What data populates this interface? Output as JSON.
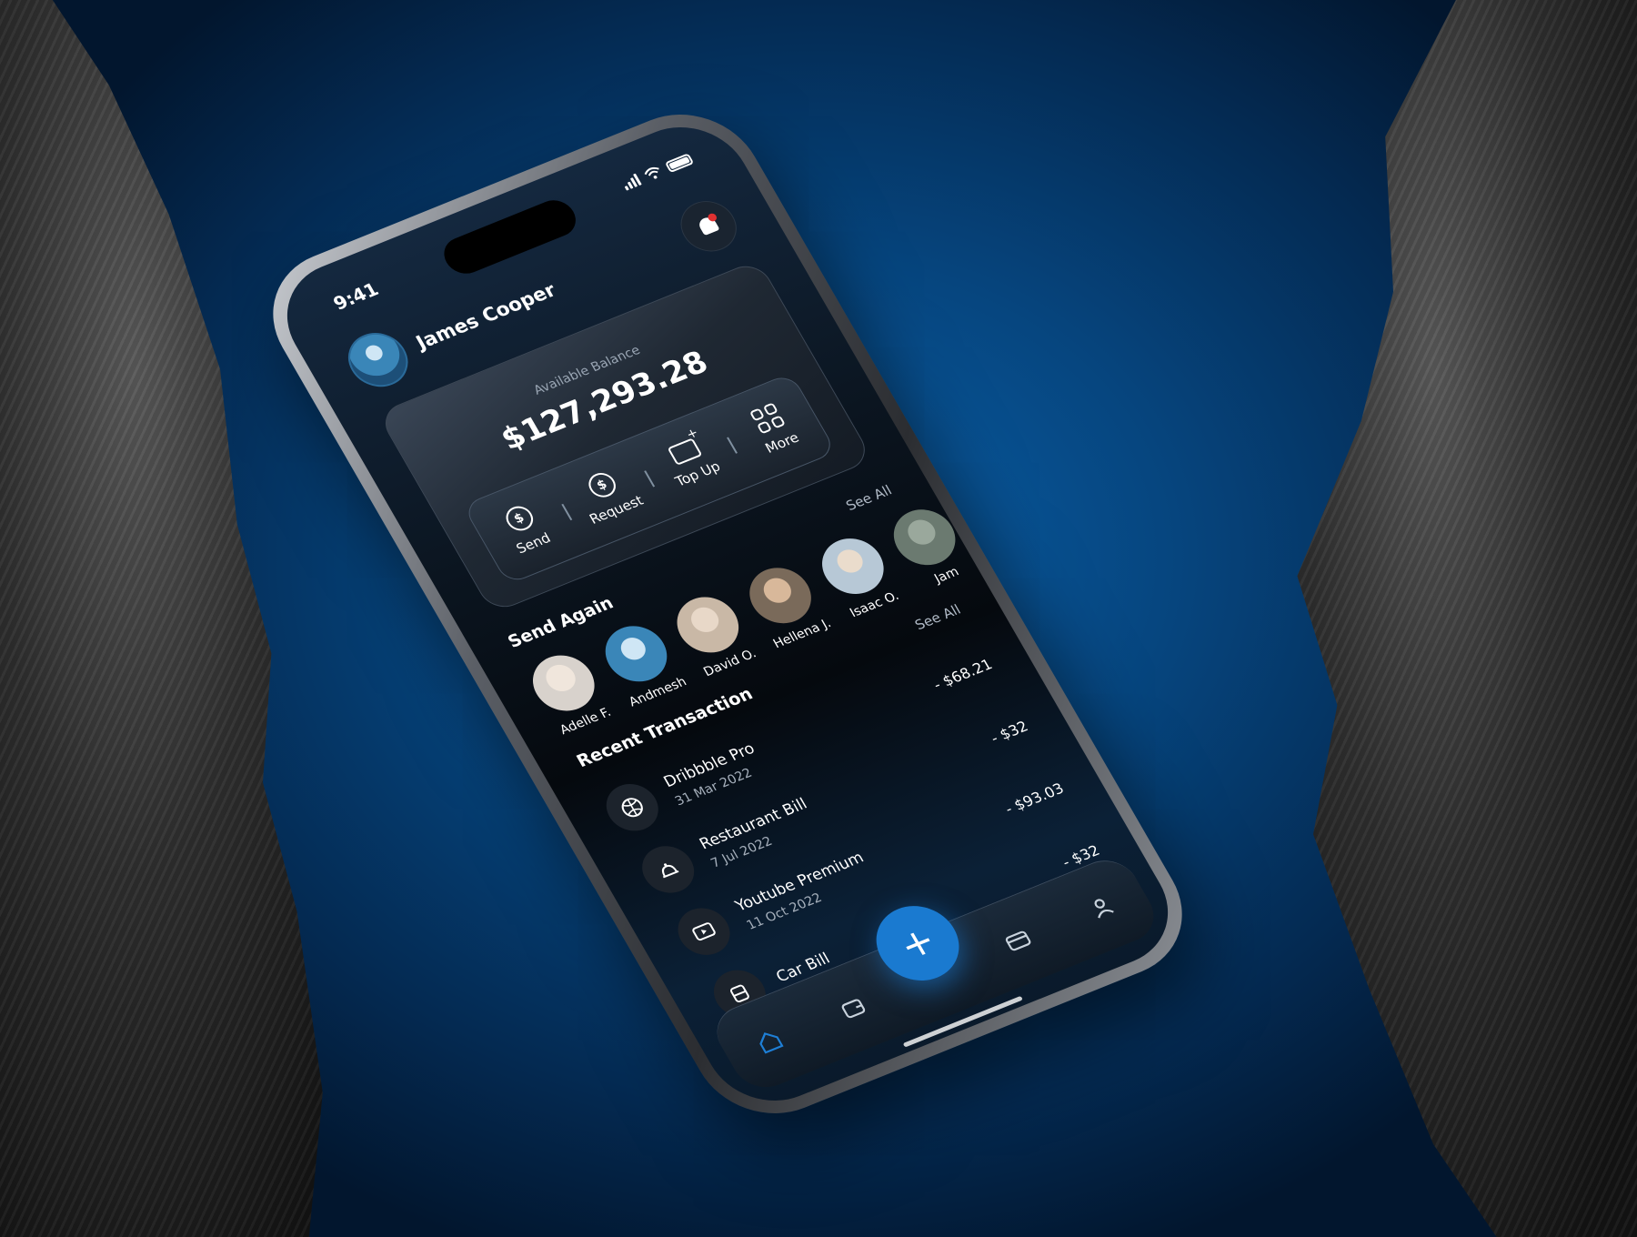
{
  "status_bar": {
    "time": "9:41"
  },
  "header": {
    "user_name": "James Cooper"
  },
  "balance": {
    "label": "Available Balance",
    "value": "$127,293.28"
  },
  "actions": [
    {
      "label": "Send",
      "icon": "send-money-icon"
    },
    {
      "label": "Request",
      "icon": "request-money-icon"
    },
    {
      "label": "Top Up",
      "icon": "top-up-card-icon"
    },
    {
      "label": "More",
      "icon": "grid-more-icon"
    }
  ],
  "send_again": {
    "title": "Send Again",
    "see_all": "See All",
    "contacts": [
      {
        "name": "Adelle F.",
        "color": "#d8d2cc"
      },
      {
        "name": "Andmesh",
        "color": "#3a86b8"
      },
      {
        "name": "David O.",
        "color": "#c9b8a6"
      },
      {
        "name": "Hellena J.",
        "color": "#7a6a5a"
      },
      {
        "name": "Isaac O.",
        "color": "#b7c8d6"
      },
      {
        "name": "Jam",
        "color": "#6b7a70"
      }
    ]
  },
  "recent": {
    "title": "Recent Transaction",
    "see_all": "See All",
    "items": [
      {
        "title": "Dribbble Pro",
        "date": "31 Mar 2022",
        "amount": "- $68.21",
        "icon": "basketball-icon"
      },
      {
        "title": "Restaurant Bill",
        "date": "7 Jul 2022",
        "amount": "- $32",
        "icon": "cloche-icon"
      },
      {
        "title": "Youtube Premium",
        "date": "11 Oct 2022",
        "amount": "- $93.03",
        "icon": "play-icon"
      },
      {
        "title": "Car Bill",
        "date": "",
        "amount": "- $32",
        "icon": "car-icon"
      }
    ]
  },
  "nav": {
    "fab_label": "+"
  },
  "colors": {
    "accent": "#1a7ad0",
    "background": "#06457e"
  }
}
